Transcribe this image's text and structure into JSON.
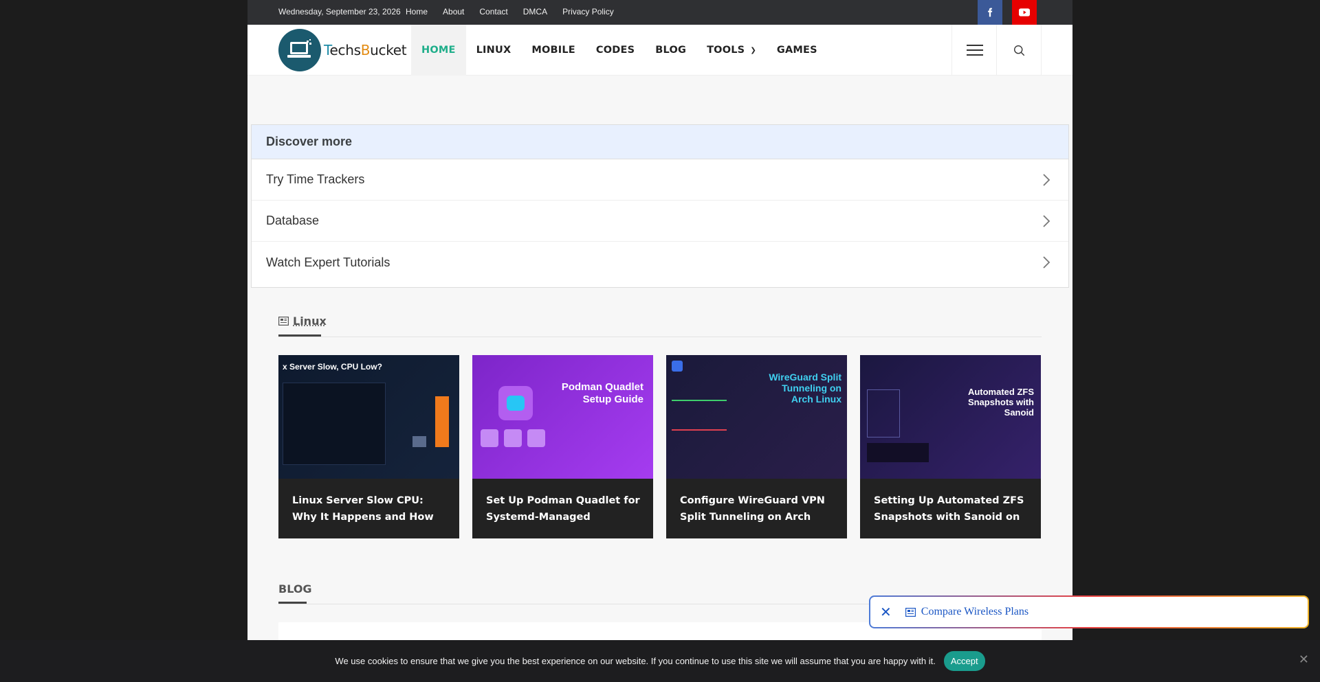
{
  "topbar": {
    "date": "Wednesday, September 23, 2026",
    "links": [
      "Home",
      "About",
      "Contact",
      "DMCA",
      "Privacy Policy"
    ]
  },
  "brand": {
    "name_part1": "T",
    "name_part2": "echs",
    "name_part3": "B",
    "name_part4": "ucket"
  },
  "nav": {
    "items": [
      "HOME",
      "LINUX",
      "MOBILE",
      "CODES",
      "BLOG",
      "TOOLS",
      "GAMES"
    ]
  },
  "discover": {
    "title": "Discover more",
    "items": [
      "Try Time Trackers",
      "Database",
      "Watch Expert Tutorials"
    ]
  },
  "linux_section": {
    "title": "Linux",
    "cards": [
      {
        "title": "Linux Server Slow CPU: Why It Happens and How to Fix It",
        "thumb_text": "x Server Slow, CPU Low?"
      },
      {
        "title": "Set Up Podman Quadlet for Systemd-Managed Containers o...",
        "thumb_text": "Podman Quadlet Setup Guide"
      },
      {
        "title": "Configure WireGuard VPN Split Tunneling on Arch Linux",
        "thumb_text": "WireGuard Split Tunneling on Arch Linux"
      },
      {
        "title": "Setting Up Automated ZFS Snapshots with Sanoid on Ubunt...",
        "thumb_text": "Automated ZFS Snapshots with Sanoid"
      }
    ]
  },
  "blog_section": {
    "title": "BLOG"
  },
  "ad": {
    "text": "Compare Wireless Plans"
  },
  "cookie": {
    "text": "We use cookies to ensure that we give you the best experience on our website. If you continue to use this site we will assume that you are happy with it.",
    "accept_label": "Accept"
  },
  "colors": {
    "accent": "#1fae8a",
    "facebook": "#3b5998",
    "youtube": "#e60000",
    "cookie_accept": "#1a9c8d"
  }
}
